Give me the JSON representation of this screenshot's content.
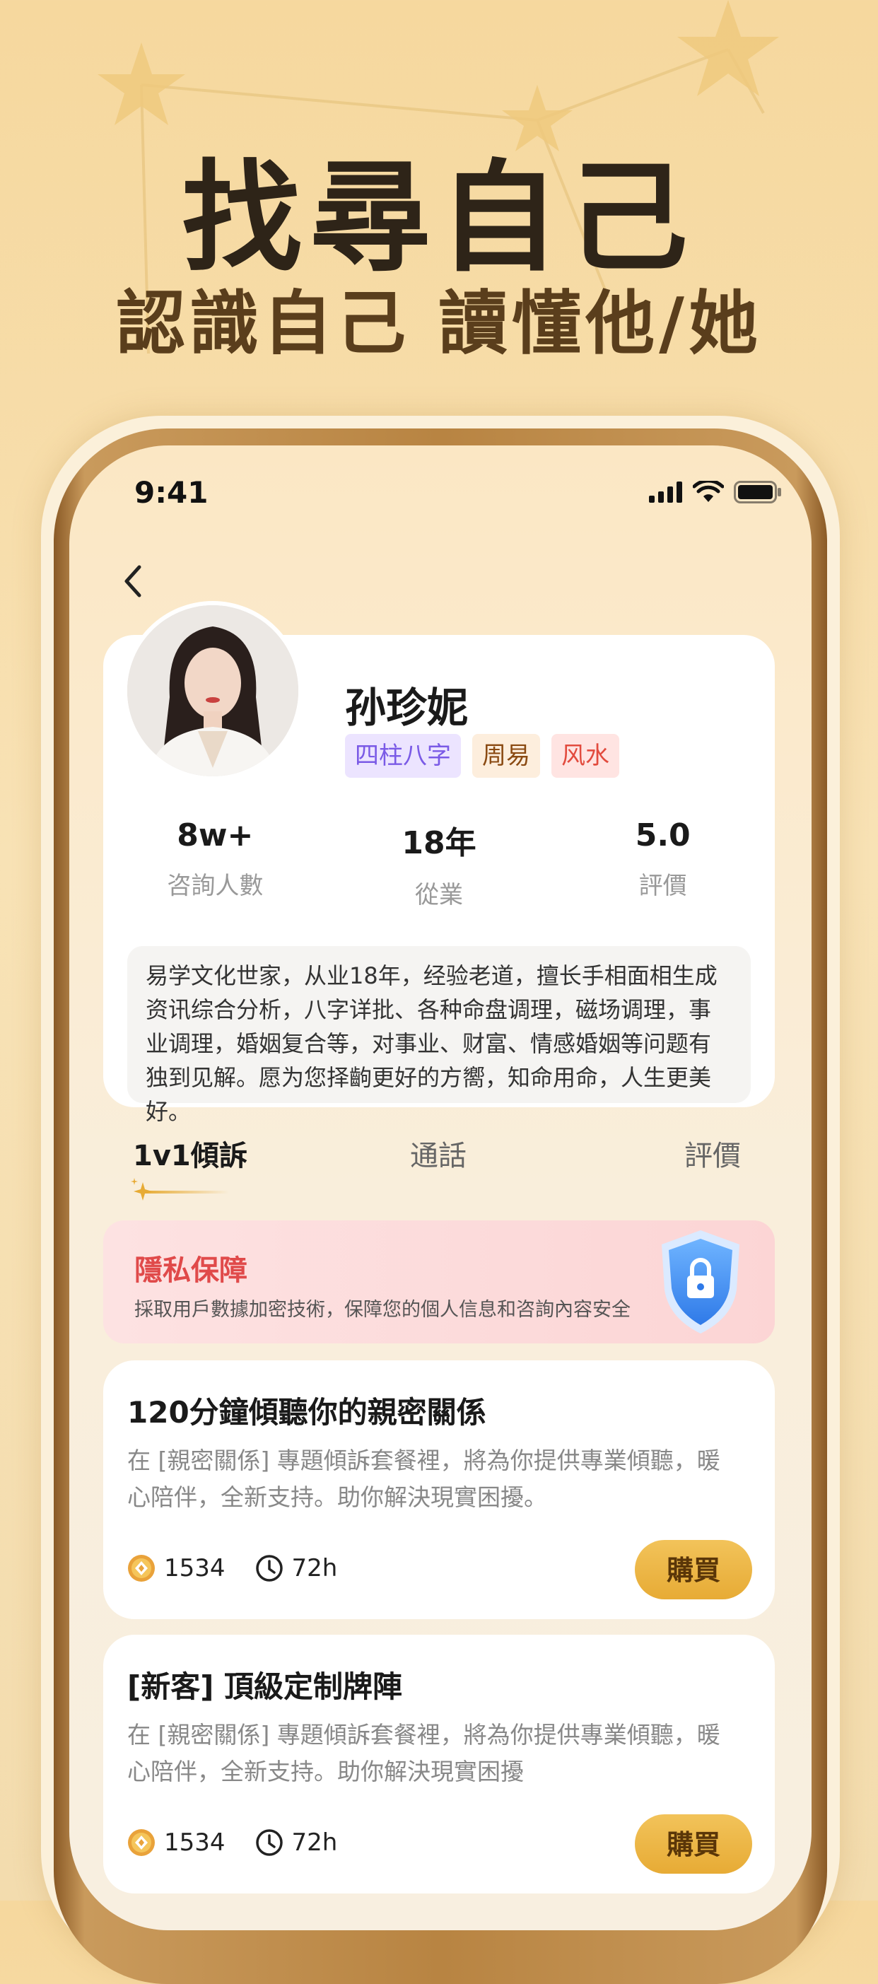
{
  "banner": {
    "headline": "找尋自己",
    "subline": "認識自己  讀懂他/她"
  },
  "status_bar": {
    "time": "9:41"
  },
  "profile": {
    "name": "孙珍妮",
    "tags": [
      "四柱八字",
      "周易",
      "风水"
    ],
    "stats": [
      {
        "value": "8w+",
        "label": "咨詢人數"
      },
      {
        "value": "18年",
        "label": "從業"
      },
      {
        "value": "5.0",
        "label": "評價"
      }
    ],
    "bio": "易学文化世家，从业18年，经验老道，擅长手相面相生成资讯综合分析，八字详批、各种命盘调理，磁场调理，事业调理，婚姻复合等，对事业、财富、情感婚姻等问题有独到见解。愿为您择齣更好的方嚮，知命用命，人生更美好。"
  },
  "tabs": [
    "1v1傾訴",
    "通話",
    "評價"
  ],
  "active_tab": 0,
  "privacy": {
    "title": "隱私保障",
    "desc": "採取用戶數據加密技術，保障您的個人信息和咨詢內容安全"
  },
  "packages": [
    {
      "title": "120分鐘傾聽你的親密關係",
      "desc": "在 [親密關係] 專題傾訴套餐裡，將為你提供專業傾聽，暖心陪伴，全新支持。助你解決現實困擾。",
      "price": "1534",
      "duration": "72h",
      "buy_label": "購買"
    },
    {
      "title": "[新客] 頂級定制牌陣",
      "desc": "在 [親密關係] 專題傾訴套餐裡，將為你提供專業傾聽，暖心陪伴，全新支持。助你解決現實困擾",
      "price": "1534",
      "duration": "72h",
      "buy_label": "購買"
    }
  ],
  "icons": [
    "back-icon",
    "signal-icon",
    "wifi-icon",
    "battery-icon",
    "coin-icon",
    "clock-icon",
    "shield-lock-icon"
  ],
  "colors": {
    "accent": "#e7ab35",
    "privacy_red": "#e04a4a",
    "headline": "#2e2418"
  }
}
